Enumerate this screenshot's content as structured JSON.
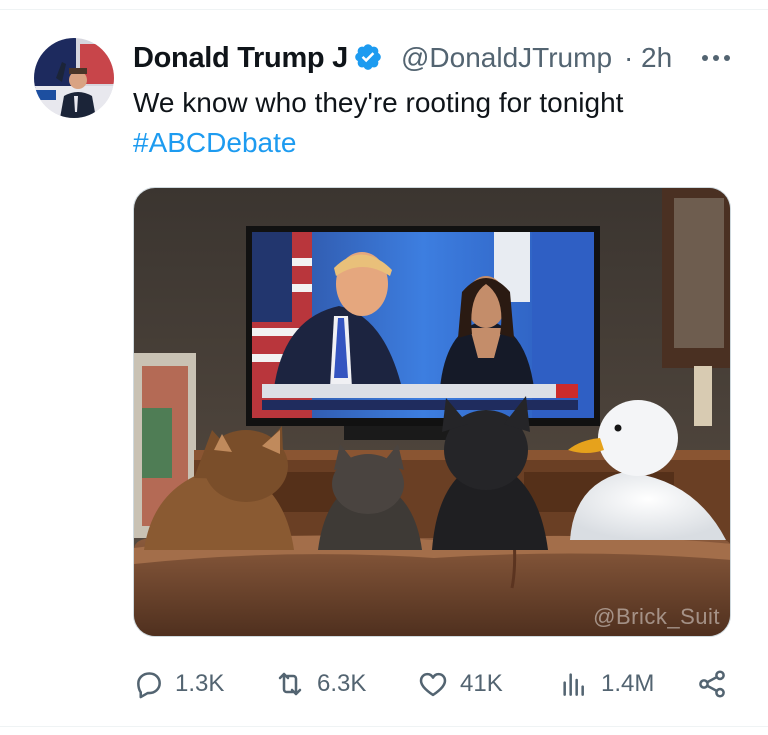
{
  "tweet": {
    "author_name": "Donald Trump J",
    "handle": "@DonaldJTrump",
    "separator": "·",
    "time": "2h",
    "text": "We know who they're rooting for tonight",
    "hashtag": "#ABCDebate",
    "image_watermark": "@Brick_Suit"
  },
  "icons": {
    "verified": "verified-badge-icon",
    "more": "more-horizontal-icon",
    "reply": "reply-bubble-icon",
    "retweet": "retweet-icon",
    "like": "heart-icon",
    "views": "bar-chart-icon",
    "share": "share-nodes-icon"
  },
  "actions": {
    "replies": "1.3K",
    "retweets": "6.3K",
    "likes": "41K",
    "views": "1.4M"
  },
  "colors": {
    "link": "#1d9bf0",
    "muted": "#536471",
    "text": "#0f1419"
  }
}
